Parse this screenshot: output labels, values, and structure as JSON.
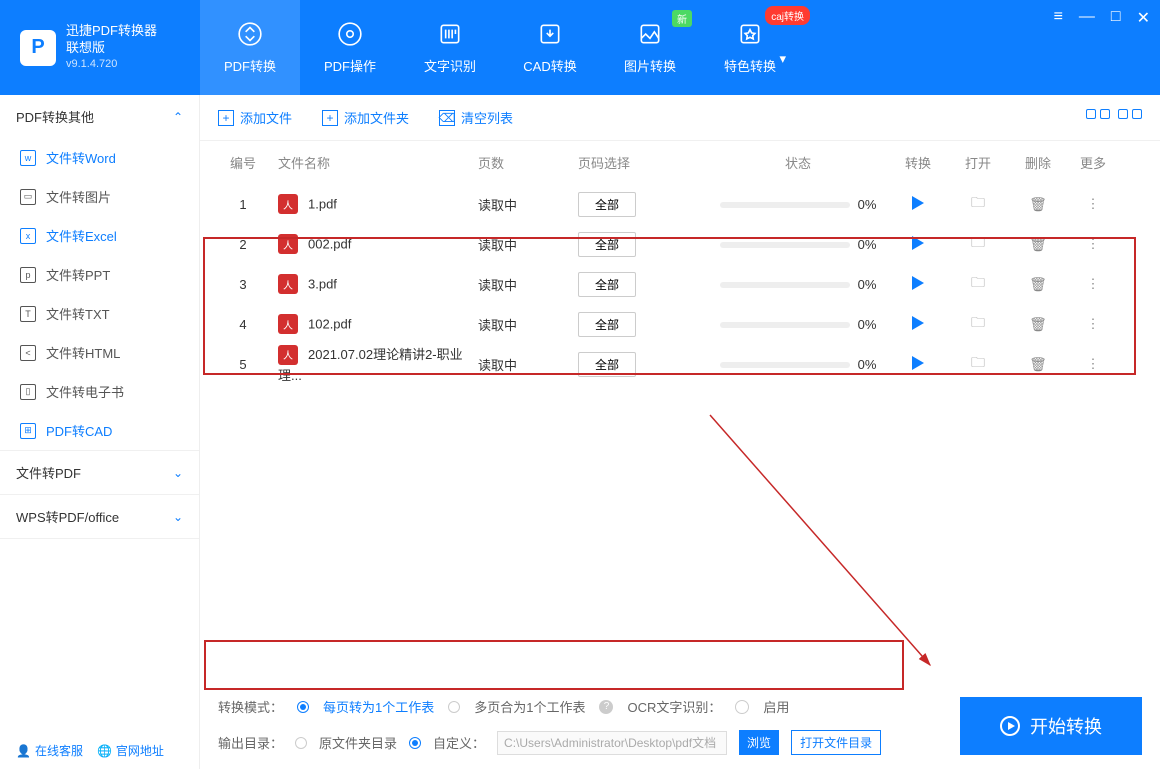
{
  "app": {
    "title": "迅捷PDF转换器",
    "subtitle": "联想版",
    "version": "v9.1.4.720"
  },
  "tabs": [
    {
      "label": "PDF转换",
      "active": true
    },
    {
      "label": "PDF操作"
    },
    {
      "label": "文字识别"
    },
    {
      "label": "CAD转换"
    },
    {
      "label": "图片转换",
      "badge": "新"
    },
    {
      "label": "特色转换",
      "badge_caj": "caj转换"
    }
  ],
  "sidebar": {
    "groups": [
      {
        "header": "PDF转换其他",
        "expanded": true,
        "items": [
          {
            "label": "文件转Word",
            "active": true,
            "icon": "w"
          },
          {
            "label": "文件转图片",
            "icon": "▢"
          },
          {
            "label": "文件转Excel",
            "blue": true,
            "icon": "x"
          },
          {
            "label": "文件转PPT",
            "icon": "p"
          },
          {
            "label": "文件转TXT",
            "icon": "T"
          },
          {
            "label": "文件转HTML",
            "icon": "<>"
          },
          {
            "label": "文件转电子书",
            "icon": "□"
          },
          {
            "label": "PDF转CAD",
            "blue": true,
            "icon": "⊞"
          }
        ]
      },
      {
        "header": "文件转PDF",
        "expanded": false
      },
      {
        "header": "WPS转PDF/office",
        "expanded": false
      }
    ],
    "footer": {
      "support": "在线客服",
      "website": "官网地址"
    }
  },
  "toolbar": {
    "add_file": "添加文件",
    "add_folder": "添加文件夹",
    "clear_list": "清空列表"
  },
  "table": {
    "headers": {
      "num": "编号",
      "name": "文件名称",
      "pages": "页数",
      "select": "页码选择",
      "status": "状态",
      "convert": "转换",
      "open": "打开",
      "delete": "删除",
      "more": "更多"
    },
    "rows": [
      {
        "num": "1",
        "name": "1.pdf",
        "pages": "读取中",
        "select": "全部",
        "status": "0%"
      },
      {
        "num": "2",
        "name": "002.pdf",
        "pages": "读取中",
        "select": "全部",
        "status": "0%"
      },
      {
        "num": "3",
        "name": "3.pdf",
        "pages": "读取中",
        "select": "全部",
        "status": "0%"
      },
      {
        "num": "4",
        "name": "102.pdf",
        "pages": "读取中",
        "select": "全部",
        "status": "0%"
      },
      {
        "num": "5",
        "name": "2021.07.02理论精讲2-职业理...",
        "pages": "读取中",
        "select": "全部",
        "status": "0%"
      }
    ]
  },
  "mode": {
    "label": "转换模式：",
    "opt1": "每页转为1个工作表",
    "opt2": "多页合为1个工作表",
    "ocr_label": "OCR文字识别：",
    "ocr_enable": "启用"
  },
  "output": {
    "label": "输出目录：",
    "opt1": "原文件夹目录",
    "opt2": "自定义：",
    "path": "C:\\Users\\Administrator\\Desktop\\pdf文档",
    "browse": "浏览",
    "open_dir": "打开文件目录"
  },
  "start_btn": "开始转换"
}
